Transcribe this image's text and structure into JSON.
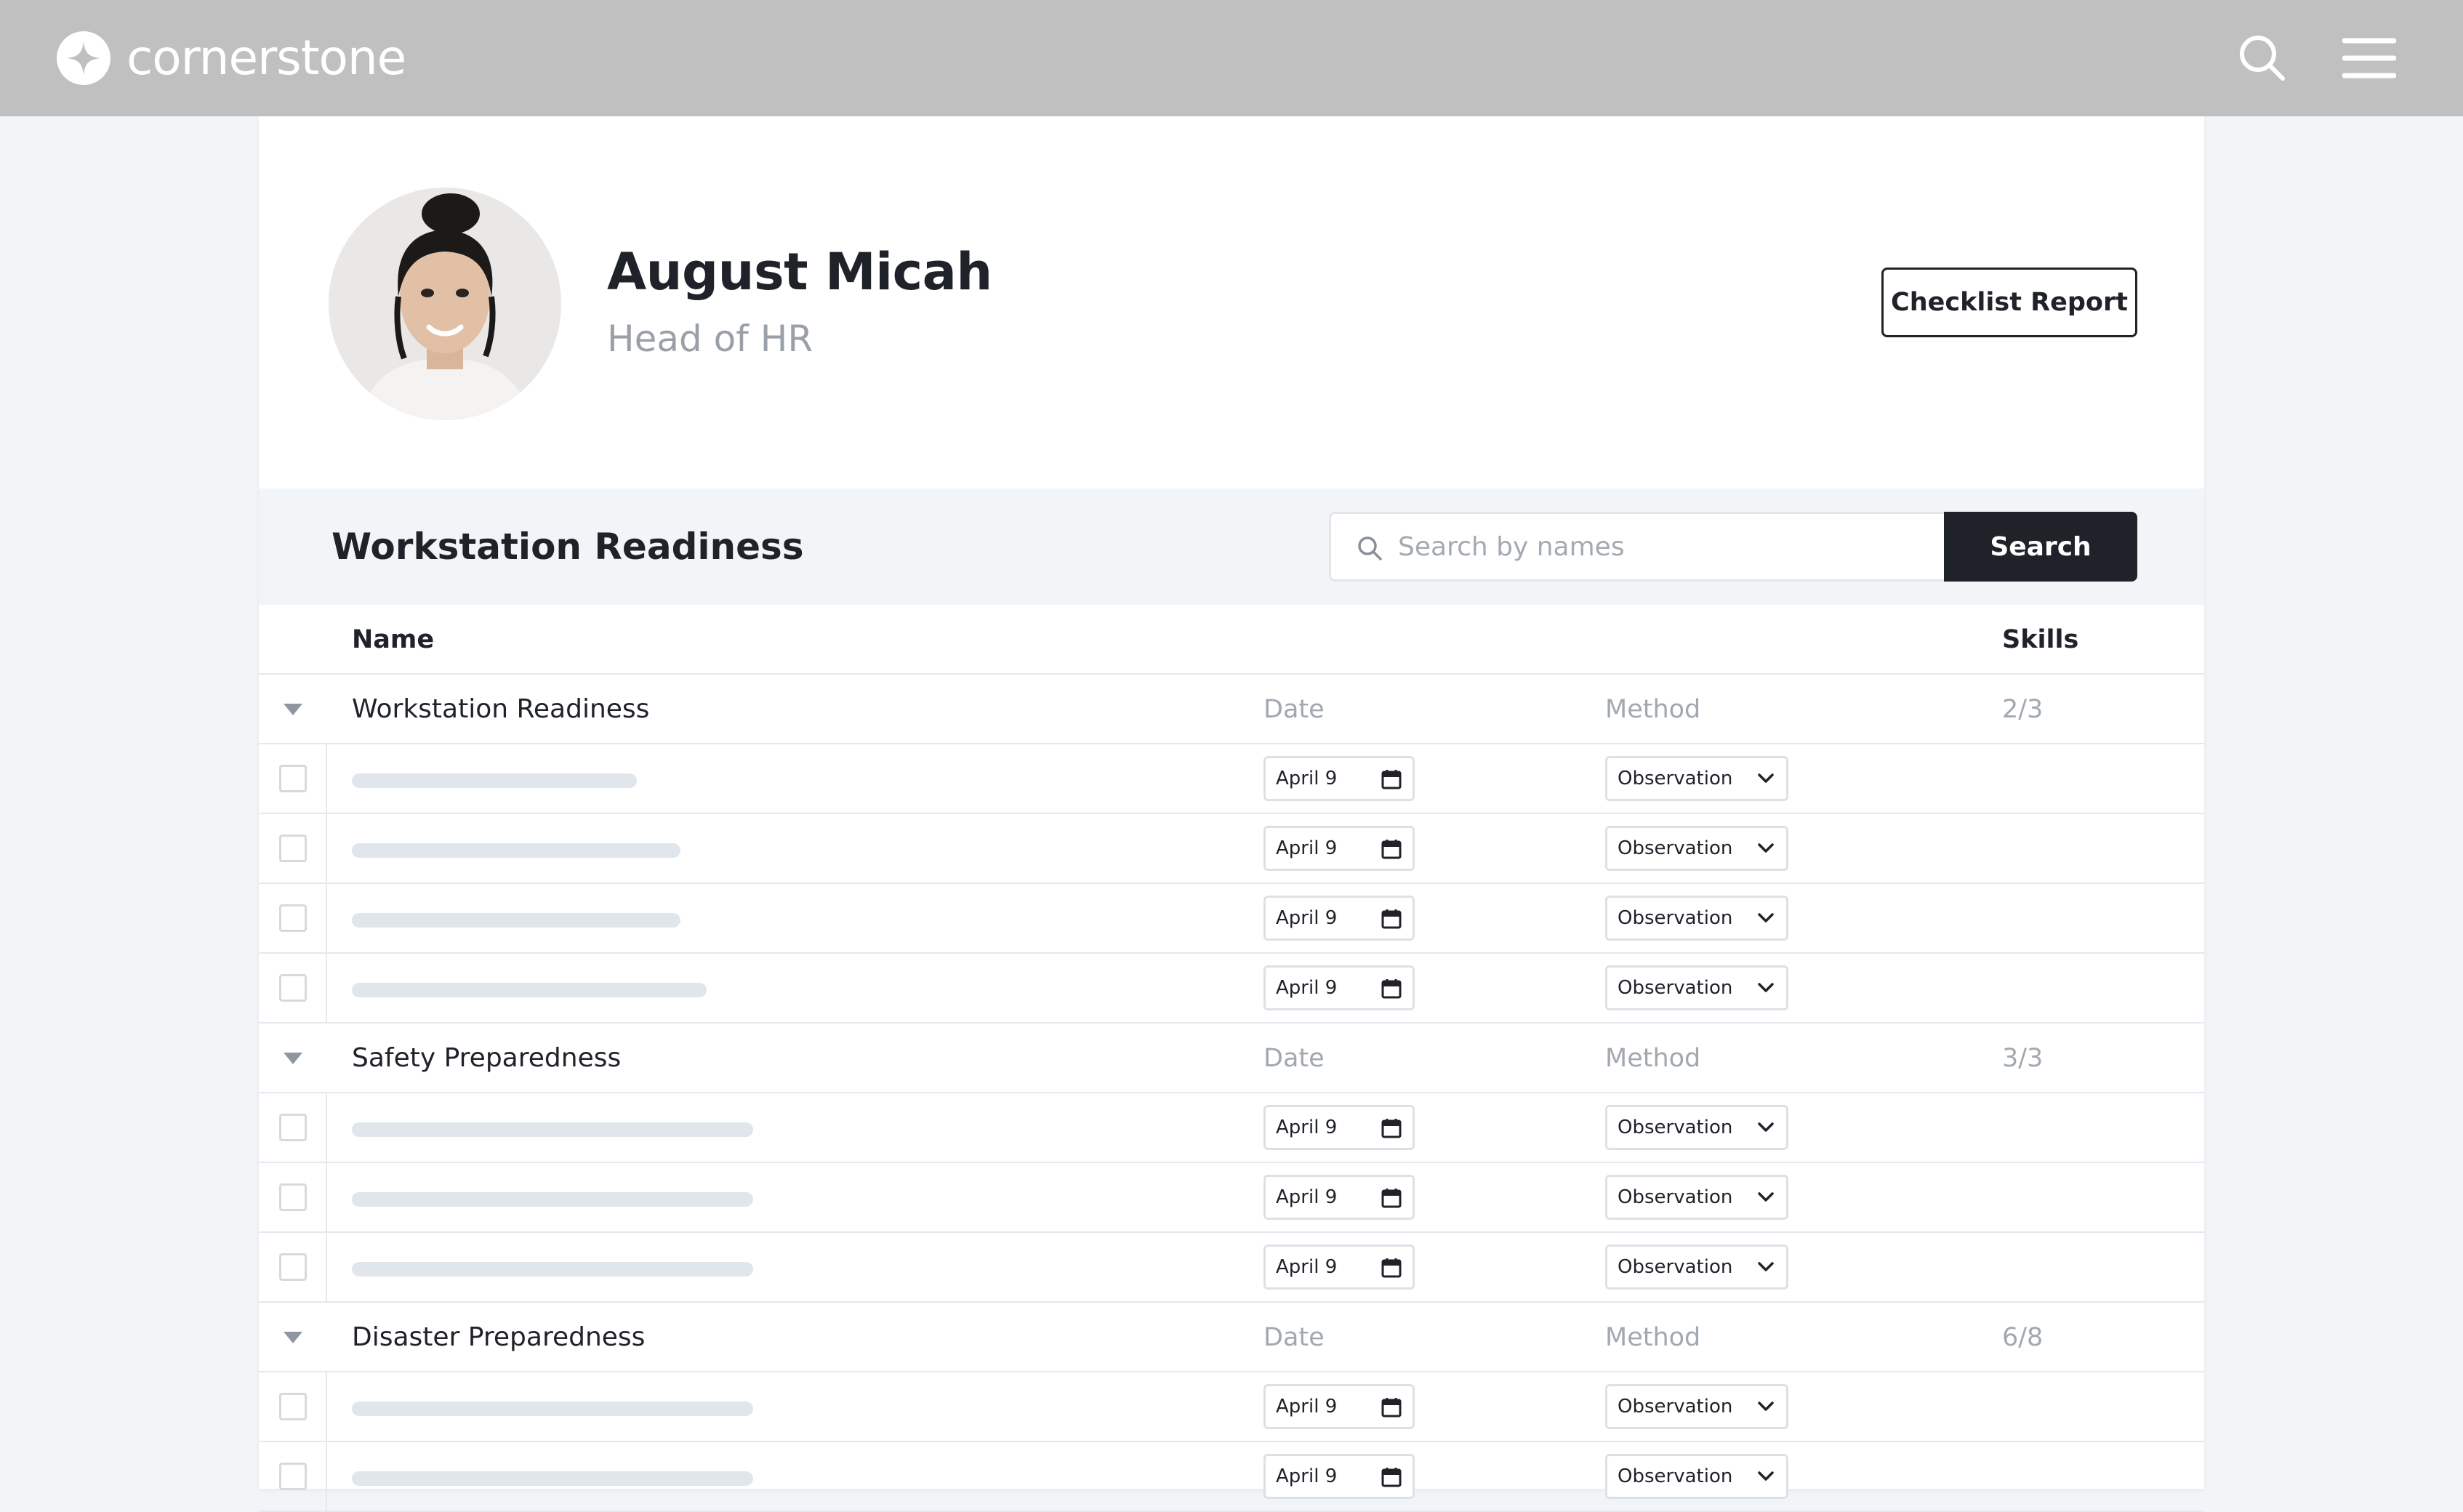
{
  "brand": {
    "name": "cornerstone"
  },
  "profile": {
    "name": "August Micah",
    "title": "Head of HR",
    "report_button": "Checklist Report"
  },
  "section": {
    "title": "Workstation Readiness",
    "search_placeholder": "Search by names",
    "search_button": "Search"
  },
  "table": {
    "col_name": "Name",
    "col_skills": "Skills",
    "groups": [
      {
        "name": "Workstation Readiness",
        "date_label": "Date",
        "method_label": "Method",
        "skills": "2/3",
        "items": [
          {
            "date": "April 9",
            "method": "Observation"
          },
          {
            "date": "April 9",
            "method": "Observation"
          },
          {
            "date": "April 9",
            "method": "Observation"
          },
          {
            "date": "April 9",
            "method": "Observation"
          }
        ]
      },
      {
        "name": "Safety Preparedness",
        "date_label": "Date",
        "method_label": "Method",
        "skills": "3/3",
        "items": [
          {
            "date": "April 9",
            "method": "Observation"
          },
          {
            "date": "April 9",
            "method": "Observation"
          },
          {
            "date": "April 9",
            "method": "Observation"
          }
        ]
      },
      {
        "name": "Disaster Preparedness",
        "date_label": "Date",
        "method_label": "Method",
        "skills": "6/8",
        "items": [
          {
            "date": "April 9",
            "method": "Observation"
          },
          {
            "date": "April 9",
            "method": "Observation"
          }
        ]
      }
    ]
  },
  "colors": {
    "topbar": "#c0c0c0",
    "primary_dark": "#1f2229",
    "band": "#f2f5f8",
    "skeleton": "#e1e6ed"
  }
}
